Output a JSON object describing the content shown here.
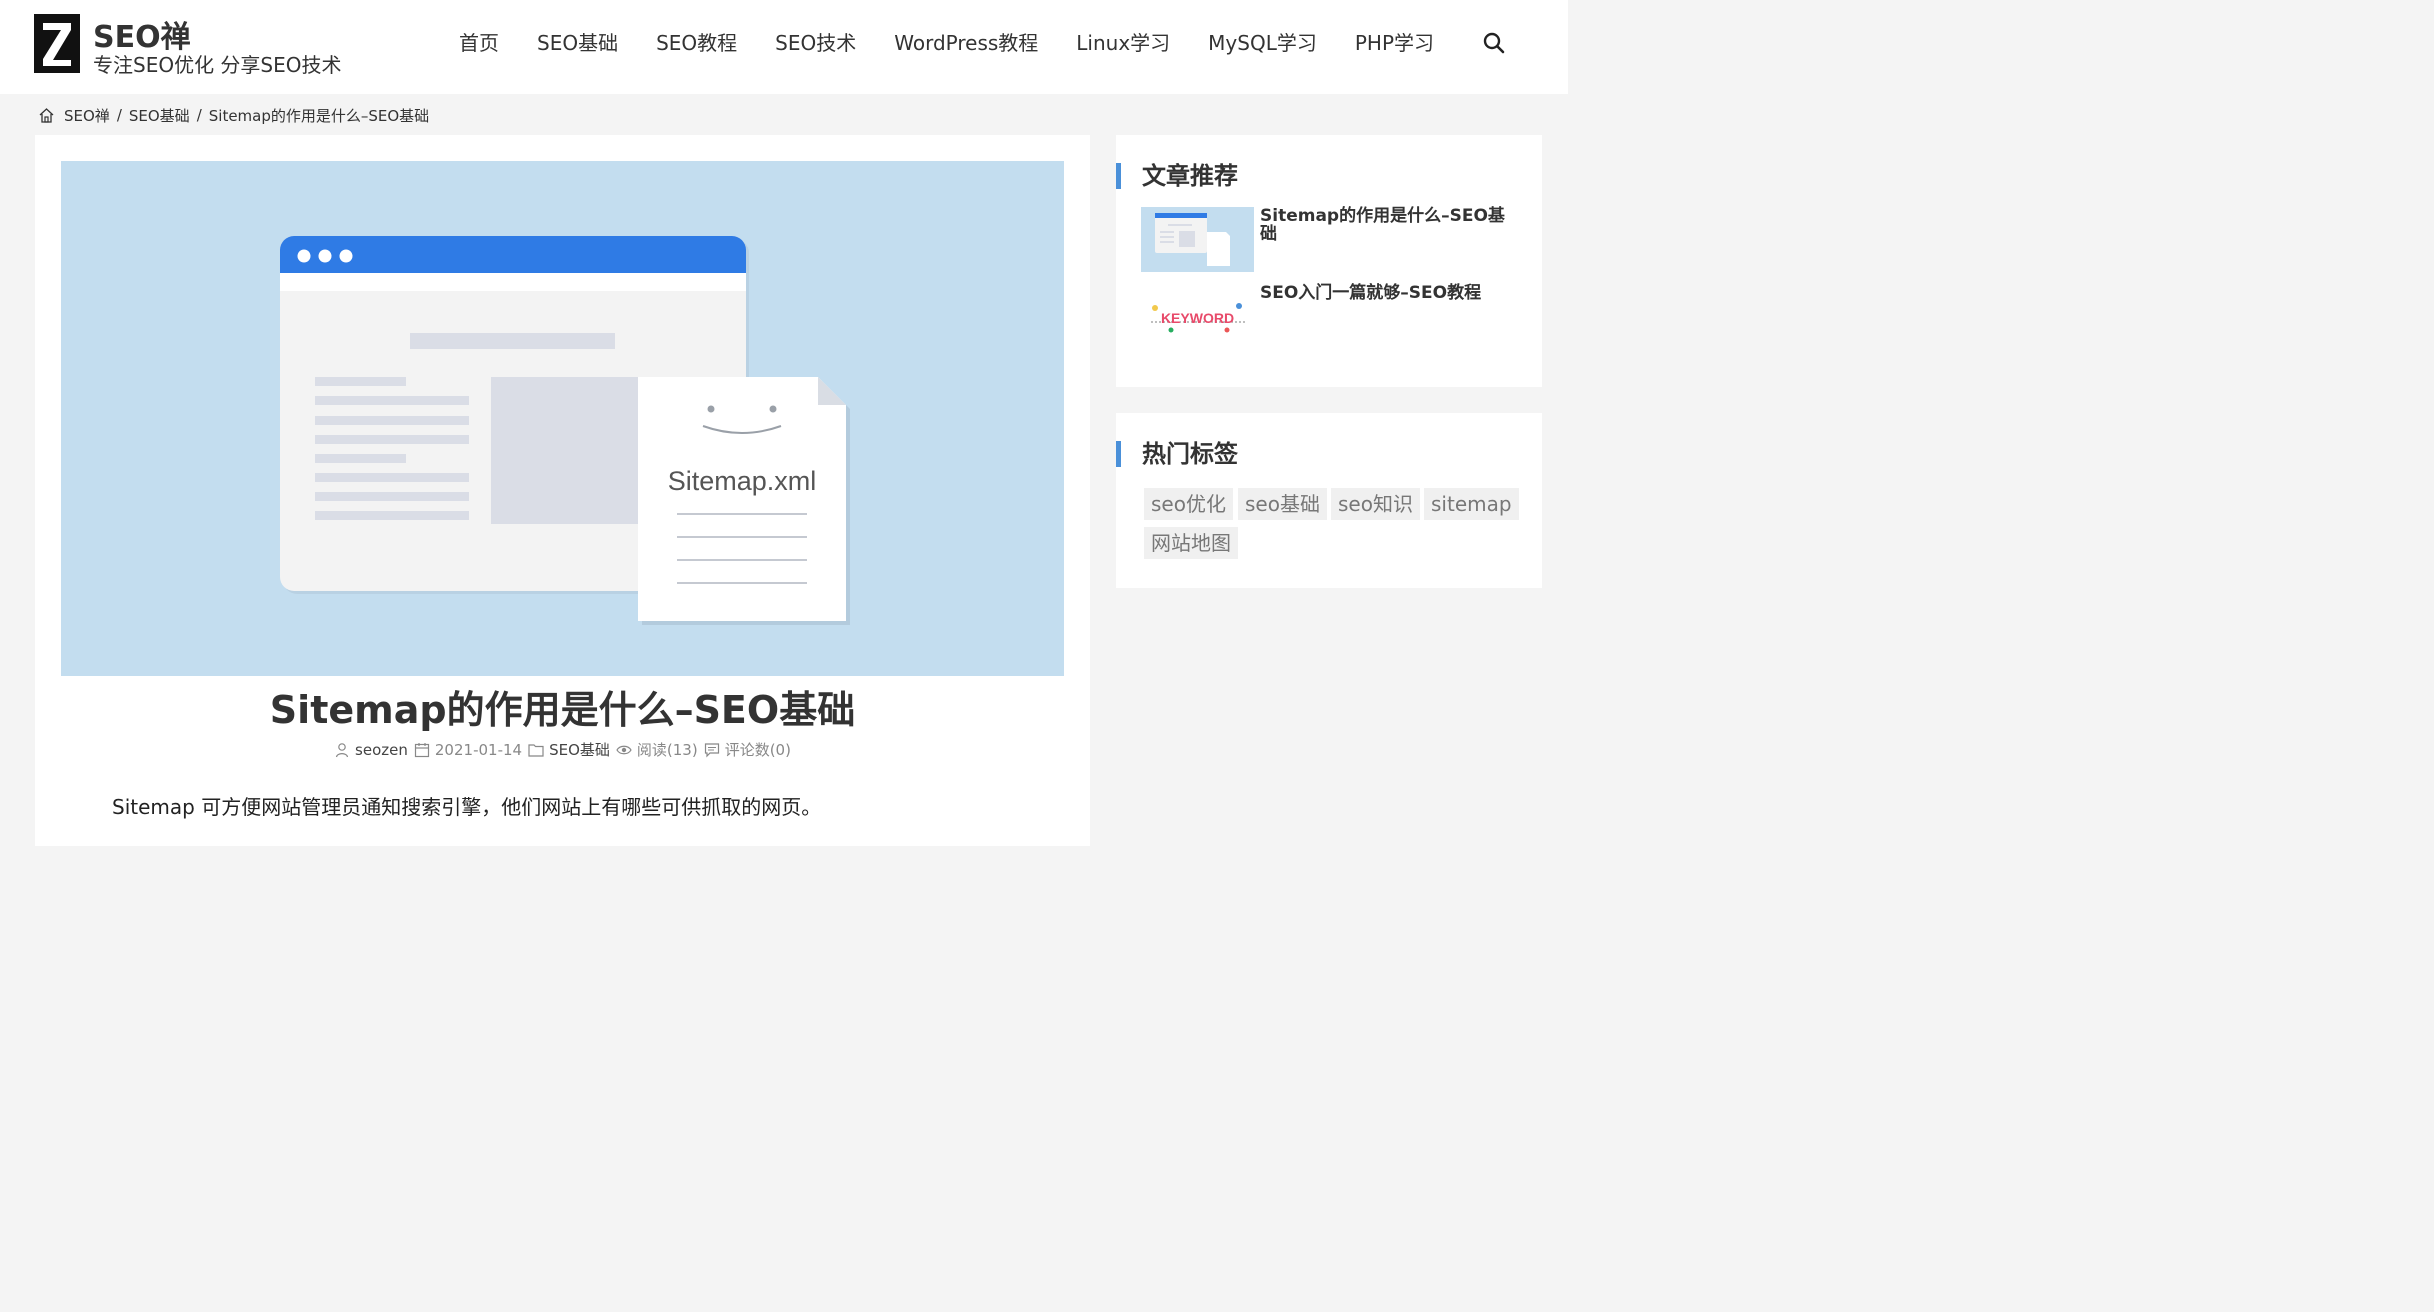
{
  "header": {
    "site_name": "SEO禅",
    "tagline": "专注SEO优化 分享SEO技术",
    "nav": [
      "首页",
      "SEO基础",
      "SEO教程",
      "SEO技术",
      "WordPress教程",
      "Linux学习",
      "MySQL学习",
      "PHP学习"
    ]
  },
  "breadcrumb": {
    "items": [
      "SEO禅",
      "SEO基础",
      "Sitemap的作用是什么–SEO基础"
    ],
    "separator": "/"
  },
  "article": {
    "hero_label": "Sitemap.xml",
    "title": "Sitemap的作用是什么–SEO基础",
    "author": "seozen",
    "date": "2021-01-14",
    "category": "SEO基础",
    "views": "阅读(13)",
    "comments": "评论数(0)",
    "intro": "Sitemap 可方便网站管理员通知搜索引擎，他们网站上有哪些可供抓取的网页。"
  },
  "sidebar": {
    "recommended": {
      "title": "文章推荐",
      "posts": [
        {
          "title": "Sitemap的作用是什么–SEO基础"
        },
        {
          "title": "SEO入门一篇就够–SEO教程",
          "thumb_text": "KEYWORD"
        }
      ]
    },
    "hot_tags": {
      "title": "热门标签",
      "tags": [
        "seo优化",
        "seo基础",
        "seo知识",
        "sitemap",
        "网站地图"
      ]
    }
  },
  "colors": {
    "accent": "#4a90d9",
    "hero_bg": "#c3ddef",
    "window_bar": "#2f7be5"
  }
}
